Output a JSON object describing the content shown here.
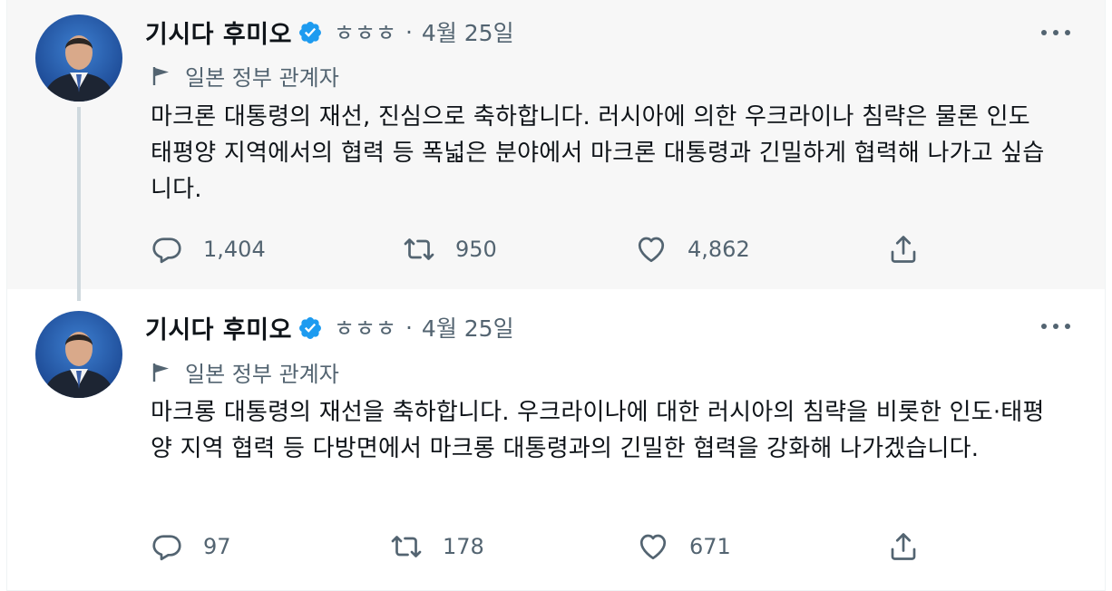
{
  "tweets": [
    {
      "author_name": "기시다 후미오",
      "handle": "ㅎㅎㅎ",
      "separator": "·",
      "date": "4월 25일",
      "affiliation": "일본 정부 관계자",
      "text": "마크론 대통령의 재선, 진심으로 축하합니다. 러시아에 의한 우크라이나 침략은 물론 인도 태평양 지역에서의 협력 등 폭넓은 분야에서 마크론 대통령과 긴밀하게 협력해 나가고 싶습니다.",
      "replies": "1,404",
      "retweets": "950",
      "likes": "4,862"
    },
    {
      "author_name": "기시다 후미오",
      "handle": "ㅎㅎㅎ",
      "separator": "·",
      "date": "4월 25일",
      "affiliation": "일본 정부 관계자",
      "text": "마크롱 대통령의 재선을 축하합니다. 우크라이나에 대한 러시아의 침략을 비롯한 인도·태평양 지역 협력 등 다방면에서 마크롱 대통령과의 긴밀한 협력을 강화해 나가겠습니다.",
      "replies": "97",
      "retweets": "178",
      "likes": "671"
    }
  ],
  "icons": {
    "verified": "verified-badge-icon",
    "affiliation": "flag-icon",
    "reply": "reply-icon",
    "retweet": "retweet-icon",
    "like": "heart-icon",
    "share": "share-icon",
    "more": "more-icon"
  },
  "colors": {
    "verified_blue": "#1d9bf0",
    "secondary_text": "#536471",
    "thread_line": "#cfd9de",
    "highlight_bg": "#f7f7f7"
  }
}
